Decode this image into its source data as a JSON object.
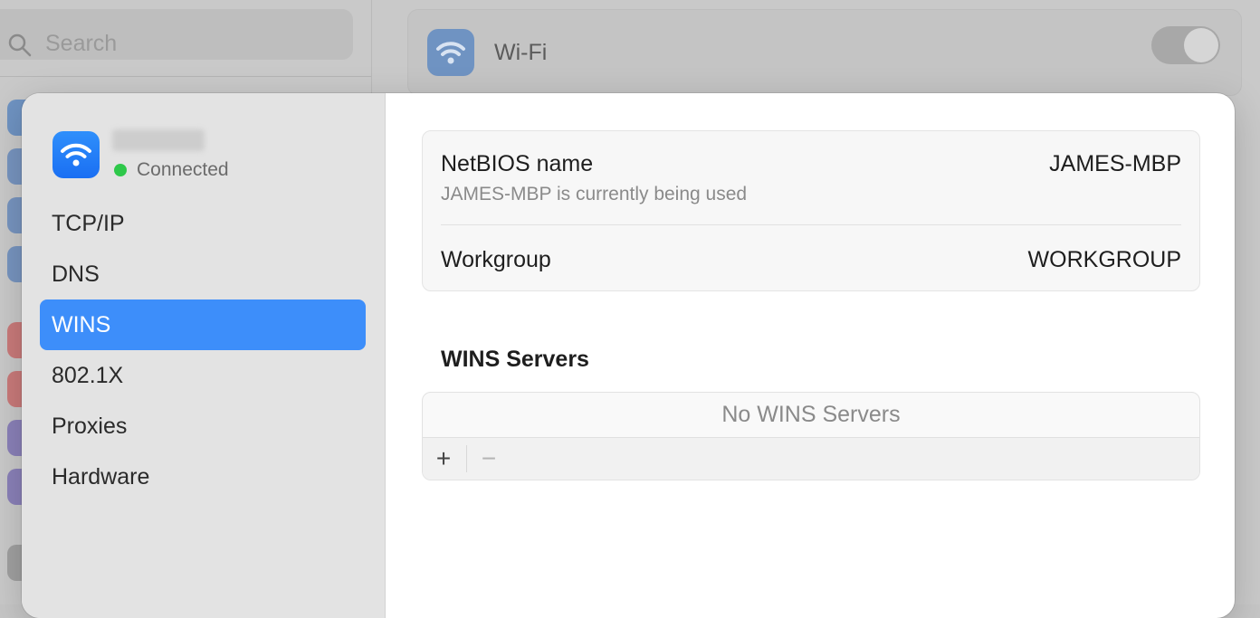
{
  "background": {
    "search": {
      "placeholder": "Search",
      "icon": "search-icon"
    },
    "wifi_row": {
      "title": "Wi-Fi",
      "icon": "wifi-icon",
      "toggle_on": false
    }
  },
  "sheet": {
    "network": {
      "icon": "wifi-icon",
      "status_text": "Connected",
      "status_color": "#2ec84a"
    },
    "nav": {
      "items": [
        {
          "label": "TCP/IP"
        },
        {
          "label": "DNS"
        },
        {
          "label": "WINS",
          "selected": true
        },
        {
          "label": "802.1X"
        },
        {
          "label": "Proxies"
        },
        {
          "label": "Hardware"
        }
      ]
    },
    "netbios": {
      "label": "NetBIOS name",
      "value": "JAMES-MBP",
      "subtitle": "JAMES-MBP is currently being used"
    },
    "workgroup": {
      "label": "Workgroup",
      "value": "WORKGROUP"
    },
    "wins_servers": {
      "title": "WINS Servers",
      "empty_text": "No WINS Servers",
      "add_label": "+",
      "remove_label": "−"
    }
  },
  "colors": {
    "accent": "#3d8efa",
    "wifi_tile": "#1a6ff3"
  }
}
